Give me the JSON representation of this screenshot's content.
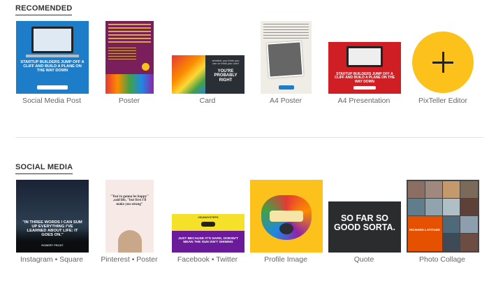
{
  "sections": {
    "recommended": {
      "title": "RECOMENDED",
      "items": [
        {
          "label": "Social Media Post"
        },
        {
          "label": "Poster"
        },
        {
          "label": "Card"
        },
        {
          "label": "A4 Poster"
        },
        {
          "label": "A4 Presentation"
        },
        {
          "label": "PixTeller Editor"
        }
      ]
    },
    "social": {
      "title": "SOCIAL MEDIA",
      "items": [
        {
          "label": "Instagram • Square"
        },
        {
          "label": "Pinterest • Poster"
        },
        {
          "label": "Facebook • Twitter"
        },
        {
          "label": "Profile Image"
        },
        {
          "label": "Quote"
        },
        {
          "label": "Photo Collage"
        }
      ]
    }
  },
  "thumbs": {
    "social_post": {
      "headline": "STARTUP BUILDERS JUMP OFF A CLIFF AND BUILD A PLANE ON THE WAY DOWN"
    },
    "card": {
      "line1": "whether you think you can or think you can't",
      "line2": "YOU'RE PROBABLY RIGHT"
    },
    "a4_presentation": {
      "headline": "STARTUP BUILDERS JUMP OFF A CLIFF AND BUILD A PLANE ON THE WAY DOWN"
    },
    "instagram": {
      "quote": "\"IN THREE WORDS I CAN SUM UP EVERYTHING I'VE LEARNED ABOUT LIFE: IT GOES ON.\"",
      "author": "ROBERT FROST"
    },
    "pinterest": {
      "quote": "\"You're gonna be happy\" ,said life, \"but first i'll make you strong\""
    },
    "facebook": {
      "tag": "#SUNNYSTEPS",
      "quote": "JUST BECAUSE IT'S DARK, DOESN'T MEAN THE SUN ISN'T SHINING"
    },
    "quote": {
      "text": "SO FAR SO GOOD SORTA."
    },
    "collage": {
      "title": "RICHARD LATITUDE"
    }
  },
  "colors": {
    "accent_yellow": "#fcc21b",
    "blue": "#1e7dc8",
    "red": "#d01e25",
    "purple": "#6a1b9a"
  }
}
